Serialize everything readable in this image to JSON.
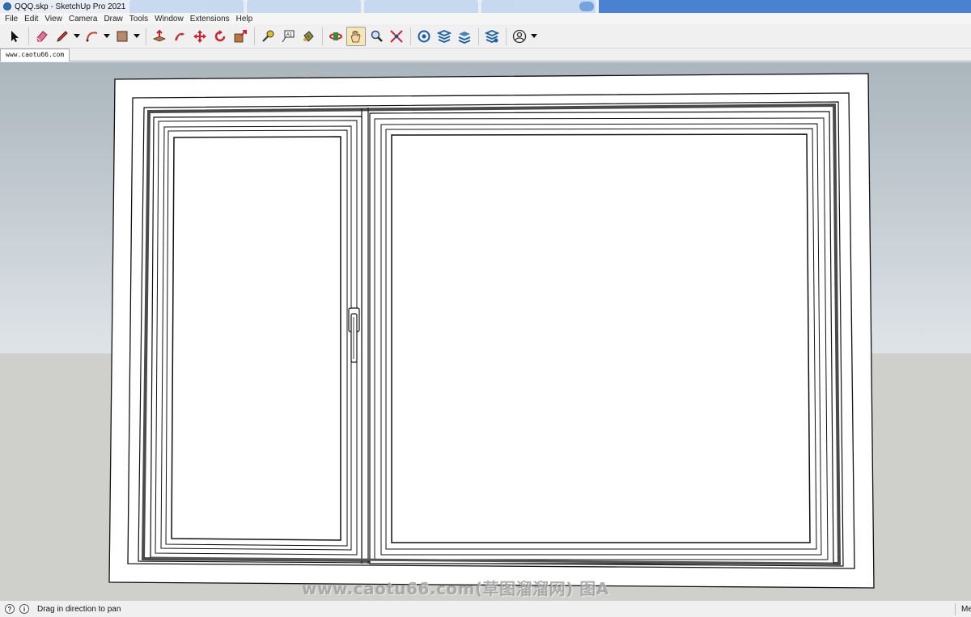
{
  "window": {
    "title": "QQQ.skp - SketchUp Pro 2021"
  },
  "menu": [
    "File",
    "Edit",
    "View",
    "Camera",
    "Draw",
    "Tools",
    "Window",
    "Extensions",
    "Help"
  ],
  "toolbar": {
    "tools": [
      {
        "icon": "select-arrow-icon"
      },
      {
        "icon": "eraser-icon"
      },
      {
        "icon": "pencil-line-icon",
        "dropdown": true
      },
      {
        "icon": "arc-icon",
        "dropdown": true
      },
      {
        "icon": "rectangle-icon",
        "dropdown": true
      },
      {
        "icon": "push-pull-icon"
      },
      {
        "icon": "follow-me-icon"
      },
      {
        "icon": "move-icon"
      },
      {
        "icon": "rotate-icon"
      },
      {
        "icon": "scale-icon"
      },
      {
        "icon": "tape-measure-icon"
      },
      {
        "icon": "text-icon"
      },
      {
        "icon": "paint-bucket-icon"
      },
      {
        "icon": "orbit-icon"
      },
      {
        "icon": "pan-hand-icon",
        "active": true
      },
      {
        "icon": "zoom-icon"
      },
      {
        "icon": "zoom-extents-icon"
      },
      {
        "icon": "3d-warehouse-icon"
      },
      {
        "icon": "extension-warehouse-icon"
      },
      {
        "icon": "layout-icon"
      },
      {
        "icon": "extension-manager-icon"
      },
      {
        "icon": "account-icon",
        "dropdown": true
      }
    ],
    "text_tool_label": "A1"
  },
  "scene_tab": {
    "label": "www.caotu66.com"
  },
  "watermark": {
    "text": "www.caotu66.com(草图溜溜网) 图A"
  },
  "status": {
    "message": "Drag in direction to pan",
    "help_glyph": "?",
    "info_glyph": "i",
    "measurement_label": "Mea"
  },
  "colors": {
    "sky_top": "#aab5bd",
    "sky_bottom": "#dfe4e8",
    "ground": "#cfd0cc",
    "active_tool": "#f6e7b7"
  }
}
